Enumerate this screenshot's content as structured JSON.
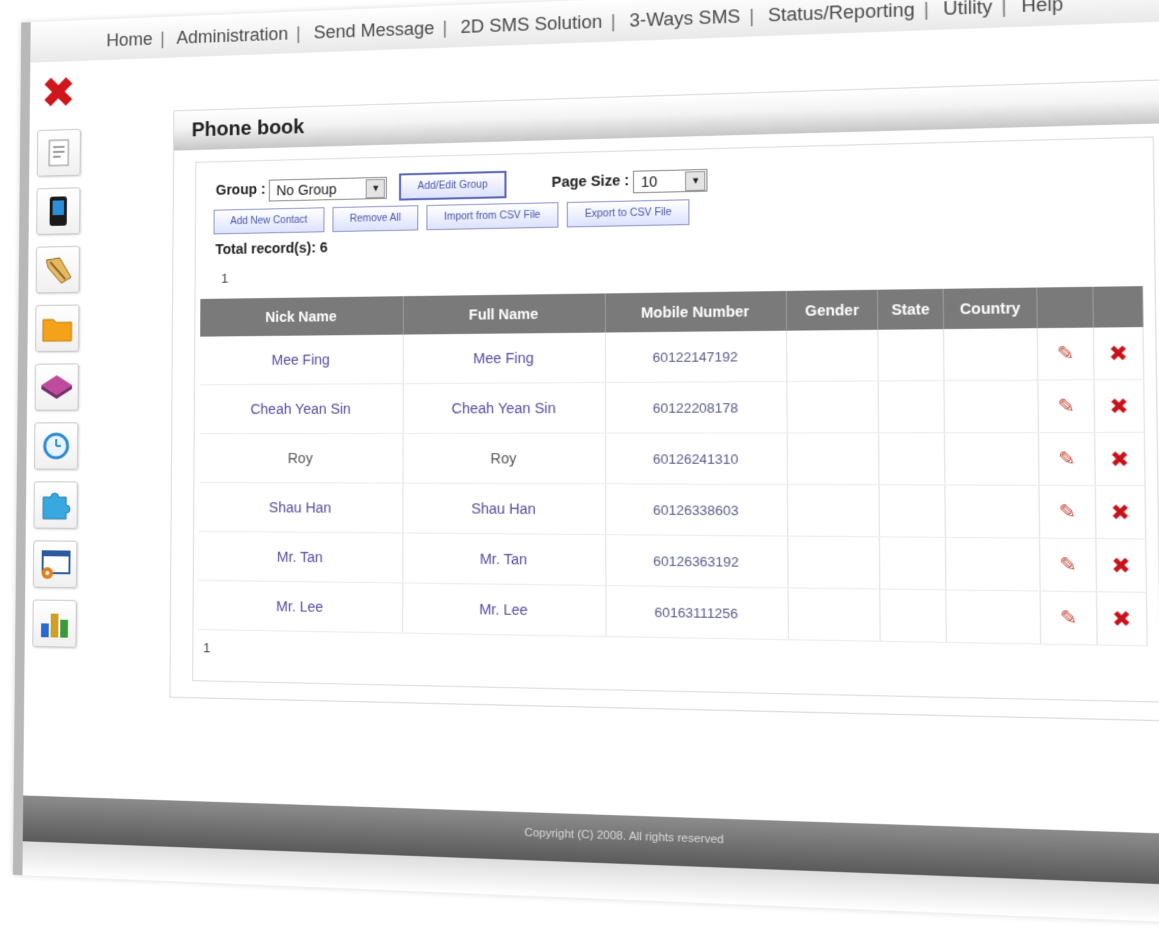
{
  "nav": {
    "items": [
      "Home",
      "Administration",
      "Send Message",
      "2D SMS Solution",
      "3-Ways SMS",
      "Status/Reporting",
      "Utility",
      "Help"
    ],
    "separator": "|"
  },
  "toolbar": {
    "icons": [
      "close-icon",
      "document-icon",
      "phone-icon",
      "tag-icon",
      "folder-icon",
      "stack-icon",
      "clock-icon",
      "puzzle-icon",
      "window-settings-icon",
      "bar-chart-icon"
    ]
  },
  "panel": {
    "title": "Phone book"
  },
  "controls": {
    "group_label": "Group :",
    "group_value": "No Group",
    "add_edit_group": "Add/Edit Group",
    "page_size_label": "Page Size :",
    "page_size_value": "10",
    "add_contact": "Add New Contact",
    "remove_all": "Remove All",
    "import_csv": "Import from CSV File",
    "export_csv": "Export to CSV File"
  },
  "total_records": "Total record(s): 6",
  "pager": {
    "top": "1",
    "bottom": "1"
  },
  "table": {
    "headers": [
      "Nick Name",
      "Full Name",
      "Mobile Number",
      "Gender",
      "State",
      "Country",
      "",
      ""
    ],
    "rows": [
      {
        "nick": "Mee Fing",
        "full": "Mee Fing",
        "mobile": "60122147192",
        "gender": "",
        "state": "",
        "country": ""
      },
      {
        "nick": "Cheah Yean Sin",
        "full": "Cheah Yean Sin",
        "mobile": "60122208178",
        "gender": "",
        "state": "",
        "country": ""
      },
      {
        "nick": "Roy",
        "full": "Roy",
        "mobile": "60126241310",
        "gender": "",
        "state": "",
        "country": ""
      },
      {
        "nick": "Shau Han",
        "full": "Shau Han",
        "mobile": "60126338603",
        "gender": "",
        "state": "",
        "country": ""
      },
      {
        "nick": "Mr. Tan",
        "full": "Mr. Tan",
        "mobile": "60126363192",
        "gender": "",
        "state": "",
        "country": ""
      },
      {
        "nick": "Mr. Lee",
        "full": "Mr. Lee",
        "mobile": "60163111256",
        "gender": "",
        "state": "",
        "country": ""
      }
    ]
  },
  "footer": {
    "copyright": "Copyright (C) 2008. All rights reserved"
  },
  "colors": {
    "header_bg": "#7a7a7a",
    "link": "#5a4aa0",
    "delete": "#c8121a",
    "button_border": "#8f95c8"
  }
}
